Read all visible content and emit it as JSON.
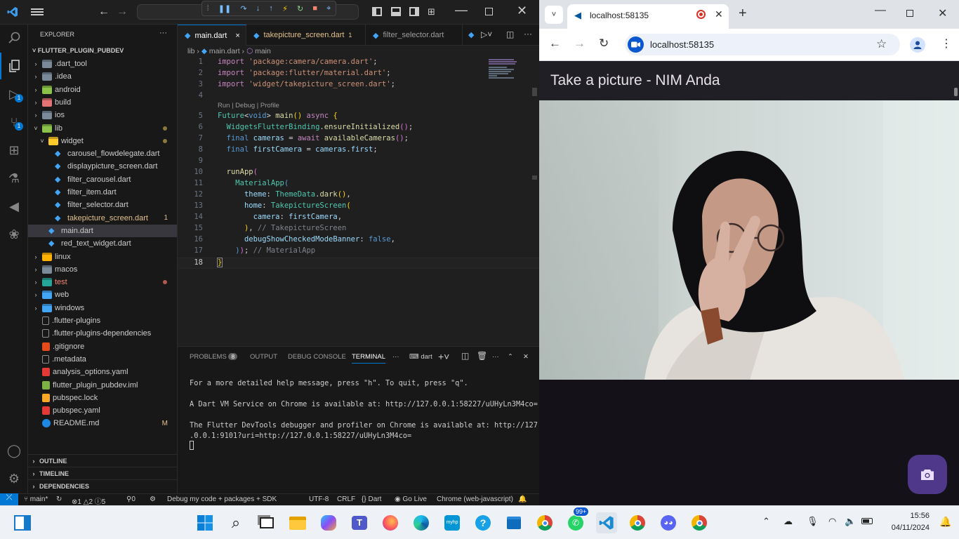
{
  "vscode": {
    "search_box": "",
    "explorer": {
      "title": "EXPLORER",
      "more": "···",
      "project": "FLUTTER_PLUGIN_PUBDEV",
      "items": [
        {
          "label": "dart_tool",
          "display": ".dart_tool",
          "depth": 1,
          "kind": "folder"
        },
        {
          "label": "idea",
          "display": ".idea",
          "depth": 1,
          "kind": "folder"
        },
        {
          "label": "android",
          "display": "android",
          "depth": 1,
          "kind": "folder"
        },
        {
          "label": "build",
          "display": "build",
          "depth": 1,
          "kind": "folder"
        },
        {
          "label": "ios",
          "display": "ios",
          "depth": 1,
          "kind": "folder"
        },
        {
          "label": "lib",
          "display": "lib",
          "depth": 1,
          "kind": "folder-open"
        },
        {
          "label": "widget",
          "display": "widget",
          "depth": 2,
          "kind": "folder-open"
        },
        {
          "label": "carousel",
          "display": "carousel_flowdelegate.dart",
          "depth": 3,
          "kind": "dart"
        },
        {
          "label": "displaypicture",
          "display": "displaypicture_screen.dart",
          "depth": 3,
          "kind": "dart"
        },
        {
          "label": "filter-carousel",
          "display": "filter_carousel.dart",
          "depth": 3,
          "kind": "dart"
        },
        {
          "label": "filter-item",
          "display": "filter_item.dart",
          "depth": 3,
          "kind": "dart"
        },
        {
          "label": "filter-selector",
          "display": "filter_selector.dart",
          "depth": 3,
          "kind": "dart"
        },
        {
          "label": "takepicture",
          "display": "takepicture_screen.dart",
          "depth": 3,
          "kind": "dart",
          "badge": "1"
        },
        {
          "label": "main",
          "display": "main.dart",
          "depth": 2,
          "kind": "dart",
          "selected": true
        },
        {
          "label": "red-text",
          "display": "red_text_widget.dart",
          "depth": 2,
          "kind": "dart"
        },
        {
          "label": "linux",
          "display": "linux",
          "depth": 1,
          "kind": "folder"
        },
        {
          "label": "macos",
          "display": "macos",
          "depth": 1,
          "kind": "folder"
        },
        {
          "label": "test",
          "display": "test",
          "depth": 1,
          "kind": "folder"
        },
        {
          "label": "web",
          "display": "web",
          "depth": 1,
          "kind": "folder"
        },
        {
          "label": "windows",
          "display": "windows",
          "depth": 1,
          "kind": "folder"
        },
        {
          "label": "flutter-plugins",
          "display": ".flutter-plugins",
          "depth": 1,
          "kind": "file"
        },
        {
          "label": "flutter-plugins-deps",
          "display": ".flutter-plugins-dependencies",
          "depth": 1,
          "kind": "file"
        },
        {
          "label": "gitignore",
          "display": ".gitignore",
          "depth": 1,
          "kind": "git"
        },
        {
          "label": "metadata",
          "display": ".metadata",
          "depth": 1,
          "kind": "file"
        },
        {
          "label": "analysis",
          "display": "analysis_options.yaml",
          "depth": 1,
          "kind": "yaml"
        },
        {
          "label": "iml",
          "display": "flutter_plugin_pubdev.iml",
          "depth": 1,
          "kind": "iml"
        },
        {
          "label": "pubspec-lock",
          "display": "pubspec.lock",
          "depth": 1,
          "kind": "lock"
        },
        {
          "label": "pubspec-yaml",
          "display": "pubspec.yaml",
          "depth": 1,
          "kind": "yaml"
        },
        {
          "label": "readme",
          "display": "README.md",
          "depth": 1,
          "kind": "info",
          "badge": "M"
        }
      ],
      "sections": [
        "OUTLINE",
        "TIMELINE",
        "DEPENDENCIES"
      ]
    },
    "tabs": [
      {
        "label": "main.dart",
        "active": true,
        "close": "×"
      },
      {
        "label": "takepicture_screen.dart",
        "badge": "1"
      },
      {
        "label": "filter_selector.dart"
      }
    ],
    "breadcrumb": {
      "folder": "lib",
      "file": "main.dart",
      "symbol": "main"
    },
    "codelens": "Run | Debug | Profile",
    "code": {
      "l1": "import 'package:camera/camera.dart';",
      "l2": "import 'package:flutter/material.dart';",
      "l3": "import 'widget/takepicture_screen.dart';",
      "l4": "",
      "l5": "Future<void> main() async {",
      "l6": "  WidgetsFlutterBinding.ensureInitialized();",
      "l7": "  final cameras = await availableCameras();",
      "l8": "  final firstCamera = cameras.first;",
      "l9": "",
      "l10": "  runApp(",
      "l11": "    MaterialApp(",
      "l12": "      theme: ThemeData.dark(),",
      "l13": "      home: TakepictureScreen(",
      "l14": "        camera: firstCamera,",
      "l15": "      ), // TakepictureScreen",
      "l16": "      debugShowCheckedModeBanner: false,",
      "l17": "    )); // MaterialApp",
      "l18": "}"
    },
    "panel": {
      "tabs": [
        "PROBLEMS",
        "OUTPUT",
        "DEBUG CONSOLE",
        "TERMINAL"
      ],
      "problems_count": "8",
      "terminal_name": "dart",
      "lines": [
        "For a more detailed help message, press \"h\". To quit, press \"q\".",
        "A Dart VM Service on Chrome is available at: http://127.0.0.1:58227/uUHyLn3M4co=",
        "The Flutter DevTools debugger and profiler on Chrome is available at: http://127",
        ".0.0.1:9101?uri=http://127.0.0.1:58227/uUHyLn3M4co="
      ]
    },
    "status": {
      "branch": "main*",
      "errors": "1",
      "warnings": "2",
      "infos": "5",
      "ports": "0",
      "debug": "Debug my code + packages + SDK",
      "encoding": "UTF-8",
      "eol": "CRLF",
      "language": "Dart",
      "golive": "Go Live",
      "device": "Chrome (web-javascript)"
    }
  },
  "chrome": {
    "tab_title": "localhost:58135",
    "address": "localhost:58135",
    "app_title": "Take a picture - NIM Anda"
  },
  "taskbar": {
    "teams_badge": "99+",
    "time": "15:56",
    "date": "04/11/2024"
  },
  "colors": {
    "accent": "#0078d4",
    "fab": "#4f378a",
    "app_bar": "#211f26"
  }
}
